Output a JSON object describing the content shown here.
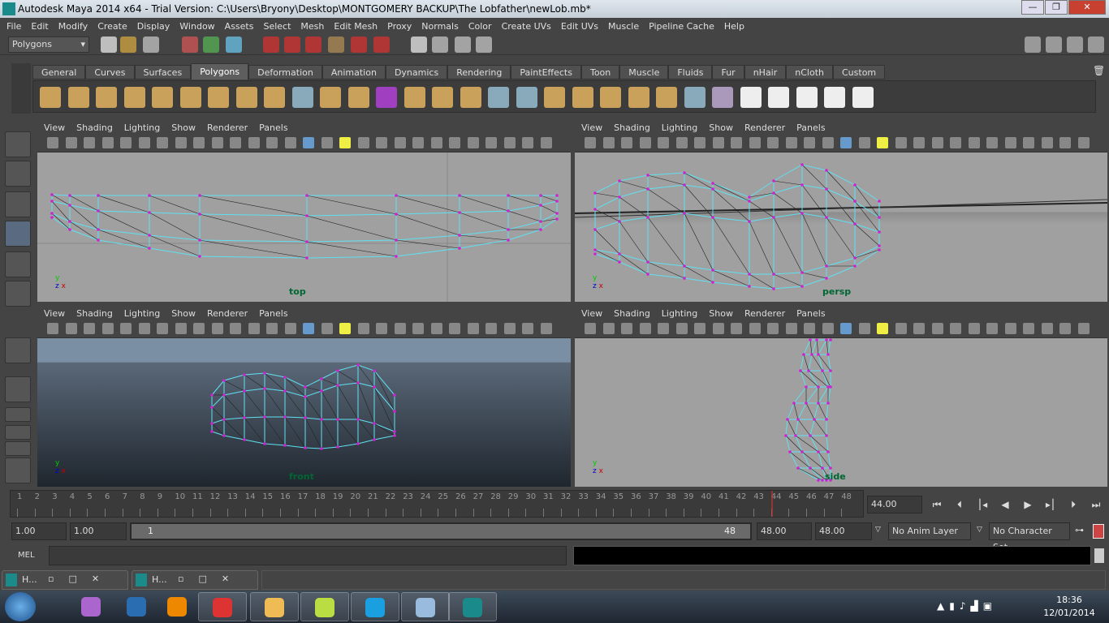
{
  "window": {
    "title": "Autodesk Maya 2014 x64 - Trial Version: C:\\Users\\Bryony\\Desktop\\MONTGOMERY BACKUP\\The Lobfather\\newLob.mb*",
    "controls": [
      "—",
      "❐",
      "✕"
    ]
  },
  "menus": [
    "File",
    "Edit",
    "Modify",
    "Create",
    "Display",
    "Window",
    "Assets",
    "Select",
    "Mesh",
    "Edit Mesh",
    "Proxy",
    "Normals",
    "Color",
    "Create UVs",
    "Edit UVs",
    "Muscle",
    "Pipeline Cache",
    "Help"
  ],
  "status": {
    "menu_set": "Polygons"
  },
  "shelf": {
    "tabs": [
      "General",
      "Curves",
      "Surfaces",
      "Polygons",
      "Deformation",
      "Animation",
      "Dynamics",
      "Rendering",
      "PaintEffects",
      "Toon",
      "Muscle",
      "Fluids",
      "Fur",
      "nHair",
      "nCloth",
      "Custom"
    ],
    "active": "Polygons"
  },
  "panel_menu": [
    "View",
    "Shading",
    "Lighting",
    "Show",
    "Renderer",
    "Panels"
  ],
  "viewports": [
    {
      "label": "top"
    },
    {
      "label": "persp"
    },
    {
      "label": "front"
    },
    {
      "label": "side"
    }
  ],
  "colors": {
    "wire": "#5fe0f0",
    "vertex": "#d020d0",
    "viewport_bg": "#a0a0a0"
  },
  "timeline": {
    "start": 1,
    "end": 48,
    "current_time": "44.00"
  },
  "range": {
    "start_time": "1.00",
    "playback_start": "1.00",
    "slider_start": "1",
    "slider_end": "48",
    "playback_end": "48.00",
    "end_time": "48.00",
    "anim_layer": "No Anim Layer",
    "character_set": "No Character Set"
  },
  "command": {
    "label": "MEL"
  },
  "minimized": [
    {
      "label": "H..."
    },
    {
      "label": "H..."
    }
  ],
  "clock": {
    "time": "18:36",
    "date": "12/01/2014"
  }
}
